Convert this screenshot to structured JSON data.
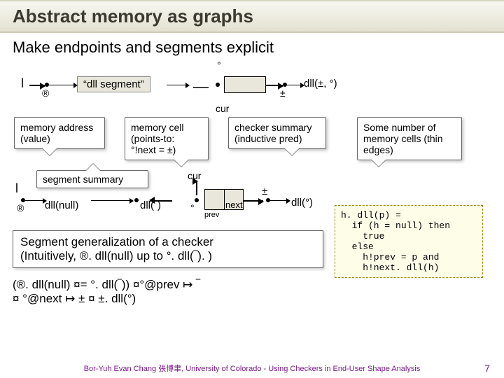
{
  "title": "Abstract memory as graphs",
  "subhead": "Make endpoints and segments explicit",
  "row1": {
    "l_var": "l",
    "reg_sym": "®",
    "seg_label": "“dll segment”",
    "bar_sym": "—",
    "pm_sym": "±",
    "dll_label": "dll(±, °)",
    "deg_marker": "°"
  },
  "cur_label": "cur",
  "callouts": {
    "mem_addr": "memory address (value)",
    "mem_cell": "memory cell (points-to: °!next = ±)",
    "checker": "checker summary (inductive pred)",
    "some_cells": "Some number of memory cells (thin edges)",
    "seg_summary": "segment summary"
  },
  "row2": {
    "l_var": "l",
    "reg_sym": "®",
    "dll_null": "dll(null)",
    "dll_bar": "dll(‾)",
    "deg_sym": "°",
    "prev_label": "prev",
    "next_label": "next",
    "pm_sym": "±",
    "dll_deg": "dll(°)",
    "cur_label": "cur",
    "bar_sym": "‾"
  },
  "genbox": {
    "line1": "Segment generalization of a checker",
    "line2": "(Intuitively, ®. dll(null) up to °. dll(‾). )"
  },
  "formula": "(®. dll(null) ¤= °. dll(‾)) ¤°@prev ↦ ‾\n¤ °@next ↦ ± ¤ ±. dll(°)",
  "checker_def": {
    "l1": "h. dll(p) =",
    "l2": "  if (h = null) then",
    "l3": "    true",
    "l4": "  else",
    "l5": "    h!prev = p and",
    "l6": "    h!next. dll(h)"
  },
  "footer": "Bor-Yuh Evan Chang 張博聿, University of Colorado - Using Checkers in End-User Shape Analysis",
  "page": "7"
}
